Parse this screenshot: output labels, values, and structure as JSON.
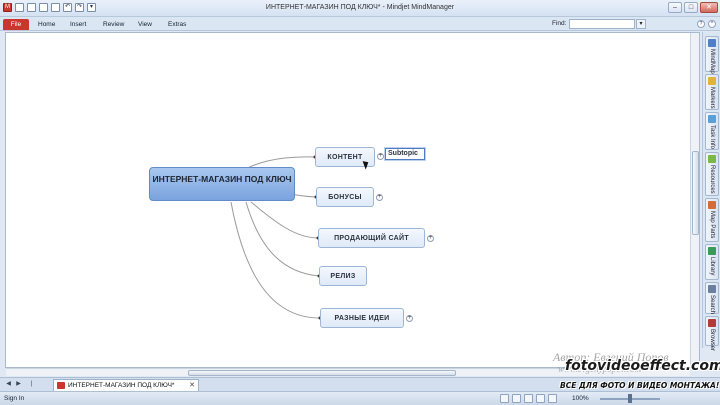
{
  "window": {
    "title": "ИНТЕРНЕТ-МАГАЗИН ПОД КЛЮЧ* - Mindjet MindManager",
    "minimize": "–",
    "maximize": "□",
    "close": "✕"
  },
  "ribbon": {
    "tabs": [
      "File",
      "Home",
      "Insert",
      "Review",
      "View",
      "Extras"
    ],
    "find_label": "Find:",
    "find_value": ""
  },
  "map": {
    "central": "ИНТЕРНЕТ-МАГАЗИН ПОД КЛЮЧ",
    "topics": [
      {
        "label": "КОНТЕНТ",
        "expander": "+"
      },
      {
        "label": "БОНУСЫ",
        "expander": "+"
      },
      {
        "label": "ПРОДАЮЩИЙ САЙТ",
        "expander": "+"
      },
      {
        "label": "РЕЛИЗ",
        "expander": ""
      },
      {
        "label": "РАЗНЫЕ ИДЕИ",
        "expander": "+"
      }
    ],
    "subtopic_edit": "Subtopic"
  },
  "task_panes": [
    "MindMap",
    "Markers",
    "Task Info",
    "Resources",
    "Map Parts",
    "Library",
    "Search",
    "Browser"
  ],
  "doc_tab": {
    "label": "ИНТЕРНЕТ-МАГАЗИН ПОД КЛЮЧ*",
    "close": "✕"
  },
  "status": {
    "signin": "Sign In",
    "zoom": "100%"
  },
  "watermark": {
    "author": "Автор: Евгений Попов",
    "site_cursive": "www.evgenypopov.com",
    "site": "fotovideoeffect.com",
    "tagline": "ВСЕ ДЛЯ ФОТО И ВИДЕО МОНТАЖА!"
  }
}
